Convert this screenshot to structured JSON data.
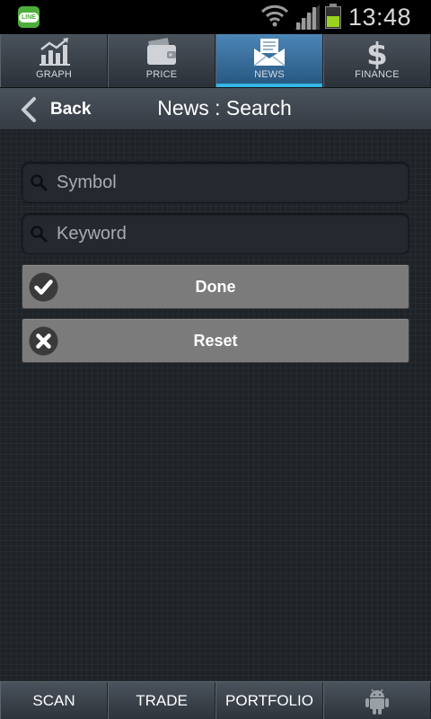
{
  "status_bar": {
    "app_icon": "line-app-icon",
    "app_icon_text": "LINE",
    "time": "13:48",
    "icons": [
      "wifi-icon",
      "signal-icon",
      "battery-icon"
    ],
    "battery_color": "#9ad31d"
  },
  "top_tabs": [
    {
      "label": "GRAPH",
      "icon": "graph-icon",
      "active": false
    },
    {
      "label": "PRICE",
      "icon": "wallet-icon",
      "active": false
    },
    {
      "label": "NEWS",
      "icon": "envelope-icon",
      "active": true
    },
    {
      "label": "FINANCE",
      "icon": "dollar-icon",
      "active": false
    }
  ],
  "title_bar": {
    "back_label": "Back",
    "title": "News : Search"
  },
  "form": {
    "symbol": {
      "placeholder": "Symbol",
      "value": ""
    },
    "keyword": {
      "placeholder": "Keyword",
      "value": ""
    },
    "done_label": "Done",
    "reset_label": "Reset"
  },
  "bottom_tabs": [
    {
      "label": "SCAN"
    },
    {
      "label": "TRADE"
    },
    {
      "label": "PORTFOLIO"
    },
    {
      "label": "",
      "icon": "android-icon"
    }
  ],
  "colors": {
    "active_tab": "#33b5e5",
    "button_bg": "#7b7b7b",
    "background": "#1e2328"
  }
}
